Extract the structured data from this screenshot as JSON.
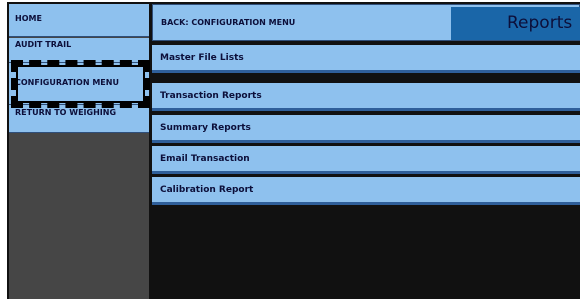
{
  "sidebar": {
    "items": [
      {
        "label": "HOME"
      },
      {
        "label": "AUDIT TRAIL"
      },
      {
        "label": "CONFIGURATION MENU"
      },
      {
        "label": "RETURN TO WEIGHING"
      }
    ]
  },
  "header": {
    "back_label": "BACK: CONFIGURATION MENU",
    "title": "Reports"
  },
  "menu": {
    "items": [
      {
        "label": "Master File Lists"
      },
      {
        "label": "Transaction Reports"
      },
      {
        "label": "Summary Reports"
      },
      {
        "label": "Email Transaction"
      },
      {
        "label": "Calibration Report"
      }
    ]
  },
  "colors": {
    "button_bg": "#8ec1ee",
    "title_bg": "#1a66a8",
    "sidebar_bg": "#464646",
    "content_bg": "#000000"
  }
}
